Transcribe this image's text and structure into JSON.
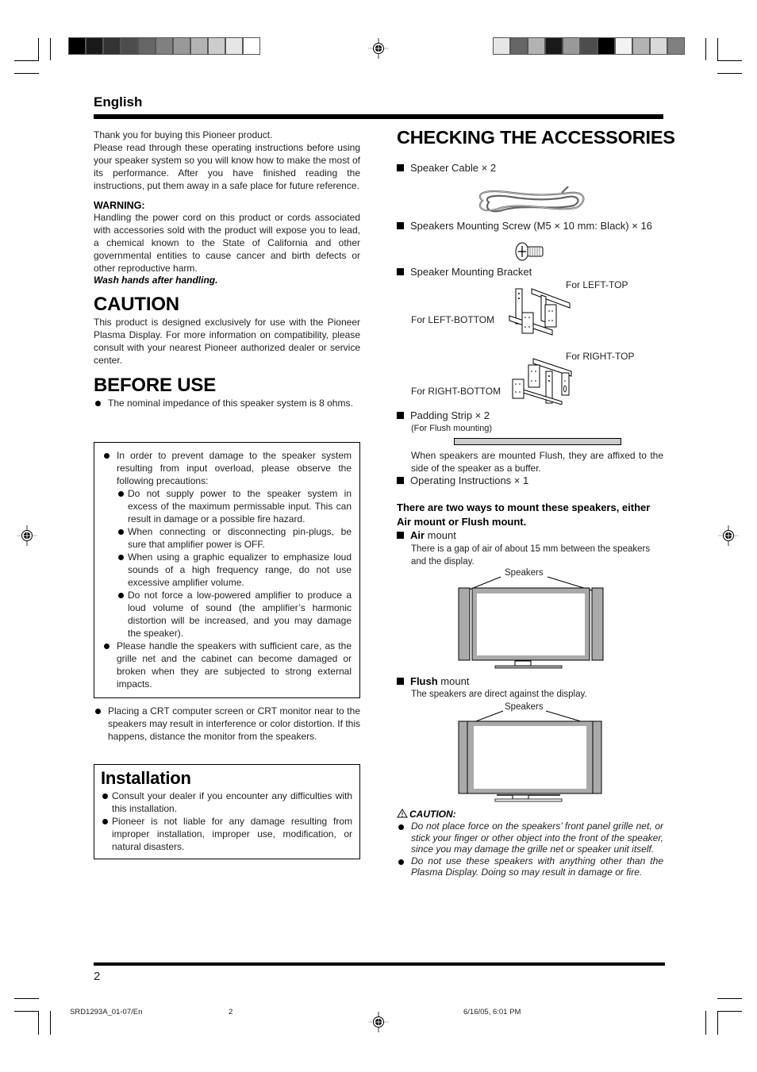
{
  "header": {
    "language": "English",
    "left_strip_colors": [
      "#000000",
      "#1a1a1a",
      "#333333",
      "#4d4d4d",
      "#666666",
      "#808080",
      "#999999",
      "#b3b3b3",
      "#cccccc",
      "#e6e6e6",
      "#ffffff"
    ],
    "right_strip_colors": [
      "#e6e6e6",
      "#666666",
      "#b3b3b3",
      "#1a1a1a",
      "#999999",
      "#4d4d4d",
      "#000000",
      "#f2f2f2",
      "#b3b3b3",
      "#d9d9d9",
      "#808080"
    ]
  },
  "intro": {
    "line1": "Thank you for buying this Pioneer product.",
    "para": "Please read through these operating instructions before using your speaker system so you will know how to make the most of its performance. After you have finished reading the instructions, put them away in a safe place for future reference."
  },
  "warning": {
    "title": "WARNING:",
    "body": "Handling the power cord on this product or cords associated with accessories sold with the product will expose you to lead, a chemical known to the State of California and other governmental entities to cause cancer and birth defects or other reproductive harm.",
    "emphasis": "Wash hands after handling."
  },
  "caution": {
    "title": "CAUTION",
    "body": "This product is designed exclusively for use with the Pioneer Plasma Display. For more information on compatibility, please consult with your nearest Pioneer authorized dealer or service center."
  },
  "before_use": {
    "title": "BEFORE USE",
    "impedance": "The nominal impedance of this speaker system is 8 ohms.",
    "box_item1": "In order to prevent damage to the speaker system resulting from input overload, please observe the following precautions:",
    "sub_items": [
      "Do not supply power to the speaker system in excess of the maximum permissable input. This can result in damage or a possible fire hazard.",
      "When connecting or disconnecting pin-plugs, be sure that amplifier power is OFF.",
      "When using a graphic equalizer to emphasize loud sounds of a high frequency range, do not use excessive amplifier volume.",
      "Do not force a low-powered amplifier to produce a loud volume of sound (the amplifier’s harmonic distortion will be increased, and you may damage the speaker)."
    ],
    "box_item2": "Please handle the speakers with sufficient care, as the grille net and the cabinet can become damaged or broken when they are subjected to strong external impacts.",
    "crt": "Placing a CRT computer screen or CRT monitor near to the speakers may result in interference or color distortion. If this happens, distance the monitor from the speakers."
  },
  "installation": {
    "title": "Installation",
    "items": [
      "Consult your dealer if you encounter any difficulties with this installation.",
      "Pioneer is not liable for any damage resulting from improper installation, improper use, modification, or natural disasters."
    ]
  },
  "accessories": {
    "title": "CHECKING THE ACCESSORIES",
    "cable": "Speaker Cable × 2",
    "screw": "Speakers Mounting Screw (M5 × 10 mm: Black) × 16",
    "bracket": "Speaker Mounting Bracket",
    "bracket_labels": {
      "left_top": "For LEFT-TOP",
      "left_bottom": "For LEFT-BOTTOM",
      "right_top": "For RIGHT-TOP",
      "right_bottom": "For RIGHT-BOTTOM"
    },
    "padding": "Padding Strip × 2",
    "padding_note": "(For Flush mounting)",
    "padding_desc": "When speakers are mounted Flush, they are affixed to the side of the speaker as a buffer.",
    "instructions": "Operating Instructions × 1"
  },
  "mounting": {
    "intro": "There are two ways to mount these speakers, either Air mount or Flush mount.",
    "air_bold": "Air",
    "air_rest": " mount",
    "air_desc": "There is a gap of air of about 15 mm between the speakers and the display.",
    "speakers_label": "Speakers",
    "flush_bold": "Flush",
    "flush_rest": " mount",
    "flush_desc": "The speakers are direct against the display."
  },
  "caution2": {
    "title": "CAUTION:",
    "items": [
      "Do not place force on the speakers’ front panel grille net, or stick your finger or other object into the front of the speaker, since you may damage the grille net or speaker unit itself.",
      "Do not use these speakers with anything other than the Plasma Display. Doing so may result in damage or fire."
    ]
  },
  "footer": {
    "page_number": "2",
    "doc_code": "SRD1293A_01-07/En",
    "slug_page": "2",
    "timestamp": "6/16/05, 6:01 PM"
  }
}
